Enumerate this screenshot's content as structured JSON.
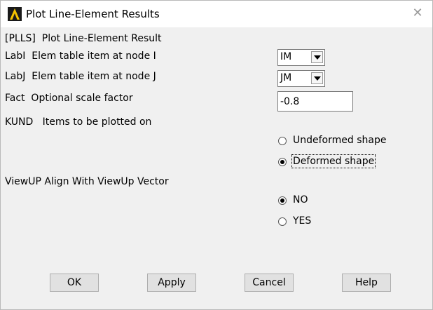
{
  "window": {
    "title": "Plot Line-Element Results",
    "close_glyph": "✕",
    "icon": "ansys-logo-icon"
  },
  "header": {
    "text": "[PLLS]  Plot Line-Element Result"
  },
  "labi": {
    "label": "LabI  Elem table item at node I",
    "selected": "IM"
  },
  "labj": {
    "label": "LabJ  Elem table item at node J",
    "selected": "JM"
  },
  "fact": {
    "label": "Fact  Optional scale factor",
    "value": "-0.8"
  },
  "kund": {
    "label": "KUND   Items to be plotted on",
    "options": [
      {
        "label": "Undeformed shape",
        "checked": false
      },
      {
        "label": "Deformed shape",
        "checked": true
      }
    ]
  },
  "viewup": {
    "label": "ViewUP Align With ViewUp Vector",
    "options": [
      {
        "label": "NO",
        "checked": true
      },
      {
        "label": "YES",
        "checked": false
      }
    ]
  },
  "buttons": {
    "ok": "OK",
    "apply": "Apply",
    "cancel": "Cancel",
    "help": "Help"
  }
}
